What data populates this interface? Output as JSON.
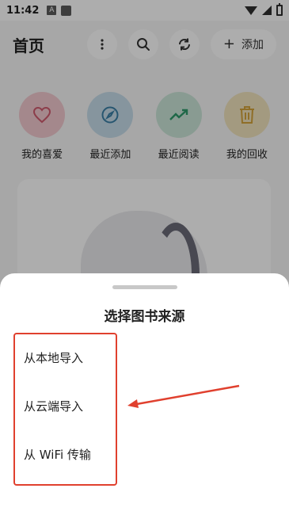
{
  "status_bar": {
    "time": "11:42",
    "notification_a": "A"
  },
  "header": {
    "title": "首页",
    "add_label": "添加",
    "add_icon": "+"
  },
  "quick_access": [
    {
      "label": "我的喜爱",
      "icon": "heart-icon",
      "color": "#f2c9cf",
      "fg": "#cf5a6e"
    },
    {
      "label": "最近添加",
      "icon": "compass-icon",
      "color": "#c6dce9",
      "fg": "#3a7fa6"
    },
    {
      "label": "最近阅读",
      "icon": "trending-up-icon",
      "color": "#cbe5d8",
      "fg": "#2f9a6b"
    },
    {
      "label": "我的回收",
      "icon": "trash-icon",
      "color": "#f1e3bd",
      "fg": "#d3a23a"
    }
  ],
  "sheet": {
    "title": "选择图书来源",
    "options": [
      "从本地导入",
      "从云端导入",
      "从 WiFi 传输"
    ]
  },
  "annotation": {
    "color": "#e0402e"
  }
}
